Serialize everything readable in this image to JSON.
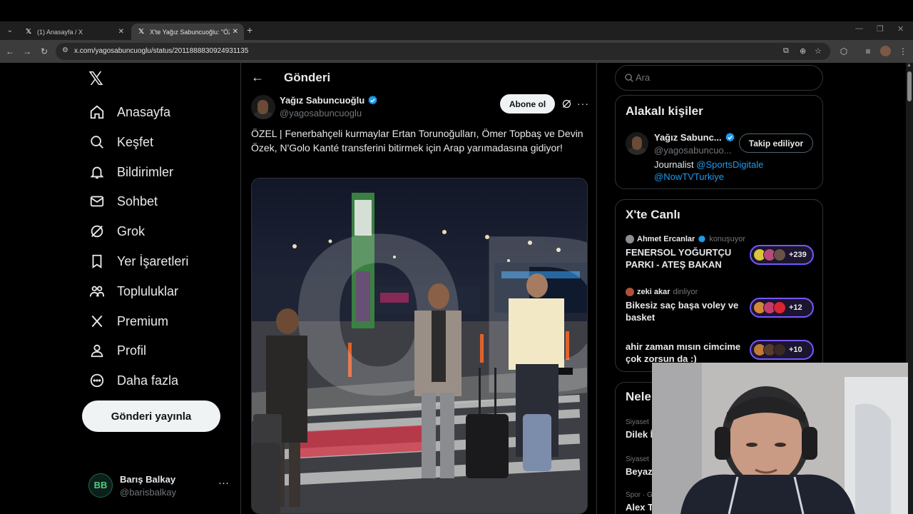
{
  "browser": {
    "tabs": [
      {
        "title": "(1) Anasayfa / X",
        "active": false
      },
      {
        "title": "X'te Yağız Sabuncuoğlu: \"ÖZEL",
        "active": true
      }
    ],
    "url": "x.com/yagosabuncuoglu/status/2011888830924931135"
  },
  "sidebar": {
    "items": [
      {
        "label": "Anasayfa",
        "icon": "home-icon"
      },
      {
        "label": "Keşfet",
        "icon": "search-icon"
      },
      {
        "label": "Bildirimler",
        "icon": "bell-icon"
      },
      {
        "label": "Sohbet",
        "icon": "mail-icon"
      },
      {
        "label": "Grok",
        "icon": "grok-icon"
      },
      {
        "label": "Yer İşaretleri",
        "icon": "bookmark-icon"
      },
      {
        "label": "Topluluklar",
        "icon": "communities-icon"
      },
      {
        "label": "Premium",
        "icon": "x-premium-icon"
      },
      {
        "label": "Profil",
        "icon": "person-icon"
      },
      {
        "label": "Daha fazla",
        "icon": "more-circle-icon"
      }
    ],
    "post_button": "Gönderi yayınla",
    "account": {
      "name": "Barış Balkay",
      "handle": "@barisbalkay",
      "avatar_initials": "BB"
    }
  },
  "main": {
    "header_title": "Gönderi",
    "post": {
      "author_name": "Yağız Sabuncuoğlu",
      "author_handle": "@yagosabuncuoglu",
      "subscribe_label": "Abone ol",
      "text": "ÖZEL | Fenerbahçeli kurmaylar Ertan Torunoğulları, Ömer Topbaş ve Devin Özek, N'Golo Kanté transferini bitirmek için Arap yarımadasına gidiyor!",
      "watermark": "OD"
    }
  },
  "right": {
    "search_placeholder": "Ara",
    "related": {
      "title": "Alakalı kişiler",
      "name": "Yağız Sabunc...",
      "handle": "@yagosabuncuo...",
      "follow_label": "Takip ediliyor",
      "bio_prefix": "Journalist",
      "mention1": "@SportsDigitale",
      "mention2": "@NowTVTurkiye"
    },
    "live": {
      "title": "X'te Canlı",
      "items": [
        {
          "host": "Ahmet Ercanlar",
          "status": "konuşuyor",
          "verified": true,
          "title": "FENERSOL YOĞURTÇU PARKI - ATEŞ BAKAN",
          "count": "+239"
        },
        {
          "host": "zeki akar",
          "status": "dinliyor",
          "verified": false,
          "title": "Bikesiz saç başa voley ve basket",
          "count": "+12"
        },
        {
          "host": "",
          "status": "",
          "verified": false,
          "title": "ahir zaman mısın cimcime çok zorsun da :)",
          "count": "+10"
        }
      ]
    },
    "news": {
      "title": "Nele",
      "items": [
        {
          "category": "Siyaset",
          "title": "Dilek İ"
        },
        {
          "category": "Siyaset",
          "title": "Beyaz"
        },
        {
          "category": "Spor · G",
          "title": "Alex T"
        }
      ]
    }
  },
  "colors": {
    "accent": "#1d9bf0",
    "live_purple": "#7856ff",
    "background": "#000000",
    "border": "#2f3336"
  }
}
